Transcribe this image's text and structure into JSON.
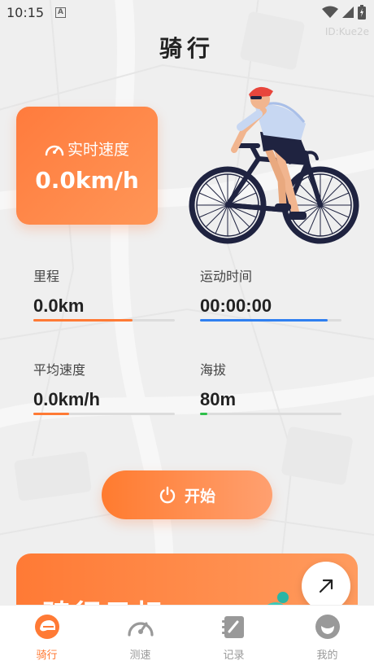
{
  "status_bar": {
    "time": "10:15",
    "notification_letter": "A"
  },
  "watermark": "ID:Kue2e",
  "page_title": "骑行",
  "speed_card": {
    "label": "实时速度",
    "value": "0.0km/h"
  },
  "metrics": [
    {
      "label": "里程",
      "value": "0.0km",
      "progress": 0.7,
      "color": "#ff7a35"
    },
    {
      "label": "运动时间",
      "value": "00:00:00",
      "progress": 0.9,
      "color": "#2f7ff0"
    },
    {
      "label": "平均速度",
      "value": "0.0km/h",
      "progress": 0.25,
      "color": "#ff7a35"
    },
    {
      "label": "海拔",
      "value": "80m",
      "progress": 0.05,
      "color": "#2ec04a"
    }
  ],
  "start_button": {
    "label": "开始"
  },
  "goal_card": {
    "title": "骑行目标"
  },
  "tabs": [
    {
      "label": "骑行",
      "icon": "helmet-icon",
      "active": true
    },
    {
      "label": "测速",
      "icon": "speedometer-icon",
      "active": false
    },
    {
      "label": "记录",
      "icon": "notebook-icon",
      "active": false
    },
    {
      "label": "我的",
      "icon": "profile-icon",
      "active": false
    }
  ],
  "colors": {
    "accent": "#ff7a35",
    "blue": "#2f7ff0",
    "green": "#2ec04a",
    "background": "#efefef"
  }
}
